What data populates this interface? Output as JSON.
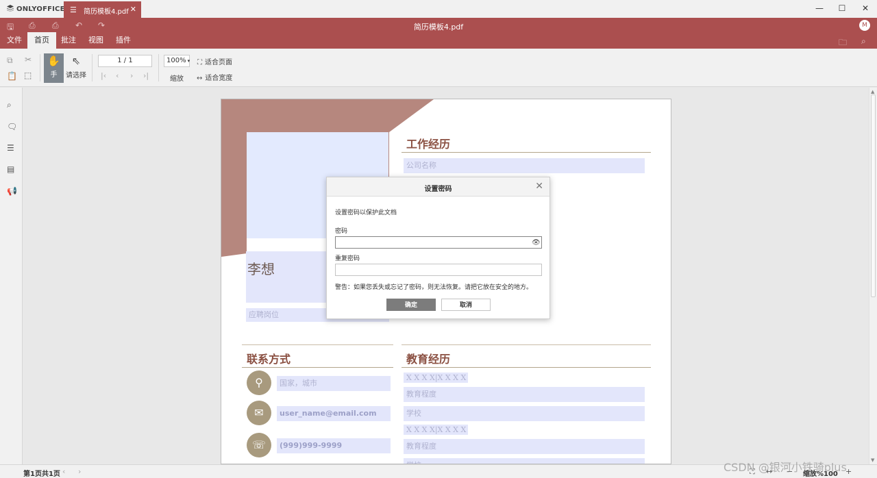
{
  "app": {
    "logo": "ONLYOFFICE",
    "tab_name": "简历模板4.pdf",
    "doc_title": "简历模板4.pdf",
    "user_initial": "M"
  },
  "menu": {
    "tabs": [
      "文件",
      "首页",
      "批注",
      "视图",
      "插件"
    ],
    "active": "首页"
  },
  "toolbar": {
    "hand_label": "手",
    "select_label": "请选择",
    "page_value": "1 / 1",
    "zoom_value": "100%",
    "zoom_label": "缩放",
    "fit_page": "适合页面",
    "fit_width": "适合宽度"
  },
  "document": {
    "name": "李想",
    "job": "应聘岗位",
    "work_title": "工作经历",
    "company": "公司名称",
    "contact_title": "联系方式",
    "location": "国家，城市",
    "email": "user_name@email.com",
    "phone": "(999)999-9999",
    "edu_title": "教育经历",
    "edu_date_1": "X X X X|X X X X",
    "edu_degree_1": "教育程度",
    "edu_school_1": "学校",
    "edu_date_2": "X X X X|X X X X",
    "edu_degree_2": "教育程度",
    "edu_school_2": "学校"
  },
  "dialog": {
    "title": "设置密码",
    "description": "设置密码以保护此文档",
    "password_label": "密码",
    "password_value": "",
    "repeat_label": "重复密码",
    "repeat_value": "",
    "warning": "警告：如果您丢失或忘记了密码，则无法恢复。请把它放在安全的地方。",
    "ok": "确定",
    "cancel": "取消"
  },
  "statusbar": {
    "page_info": "第1页共1页",
    "zoom_info": "缩放%100"
  },
  "watermark": "CSDN @银河小铁骑plus",
  "colors": {
    "brand": "#ab4f4f",
    "page_deco": "#b6877e",
    "section_title": "#8a4f41",
    "field_bg": "#e3e6fb",
    "icon_circle": "#a89a7e"
  }
}
